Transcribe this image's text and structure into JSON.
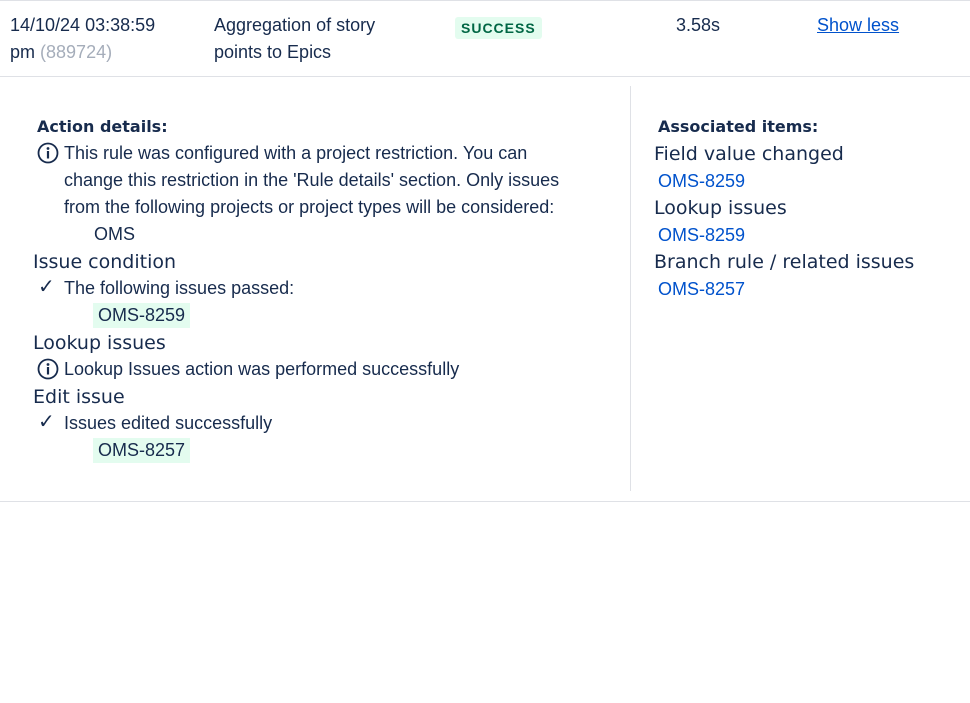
{
  "summary_row": {
    "timestamp": "14/10/24 03:38:59",
    "timestamp_suffix": "pm",
    "run_id": "(889724)",
    "rule_line1": "Aggregation of story",
    "rule_line2": "points to Epics",
    "status": "SUCCESS",
    "duration": "3.58s",
    "toggle_label": "Show less"
  },
  "action_details": {
    "heading": "Action details:",
    "restriction_line1": "This rule was configured with a project restriction. You can",
    "restriction_line2": "change this restriction in the 'Rule details' section. Only issues",
    "restriction_line3": "from the following projects or project types will be considered:",
    "project": "OMS",
    "issue_condition": {
      "title": "Issue condition",
      "message": "The following issues passed:",
      "issue": "OMS-8259"
    },
    "lookup_issues": {
      "title": "Lookup issues",
      "message": "Lookup Issues action was performed successfully"
    },
    "edit_issue": {
      "title": "Edit issue",
      "message": "Issues edited successfully",
      "issue": "OMS-8257"
    }
  },
  "associated_items": {
    "heading": "Associated items:",
    "groups": [
      {
        "title": "Field value changed",
        "issue": "OMS-8259"
      },
      {
        "title": "Lookup issues",
        "issue": "OMS-8259"
      },
      {
        "title": "Branch rule / related issues",
        "issue": "OMS-8257"
      }
    ]
  },
  "icons": {
    "info": "info-icon",
    "check": "checkmark-icon"
  },
  "colors": {
    "success_bg": "#e3fcef",
    "success_text": "#006644",
    "link": "#0052cc",
    "muted": "#a5adba"
  }
}
